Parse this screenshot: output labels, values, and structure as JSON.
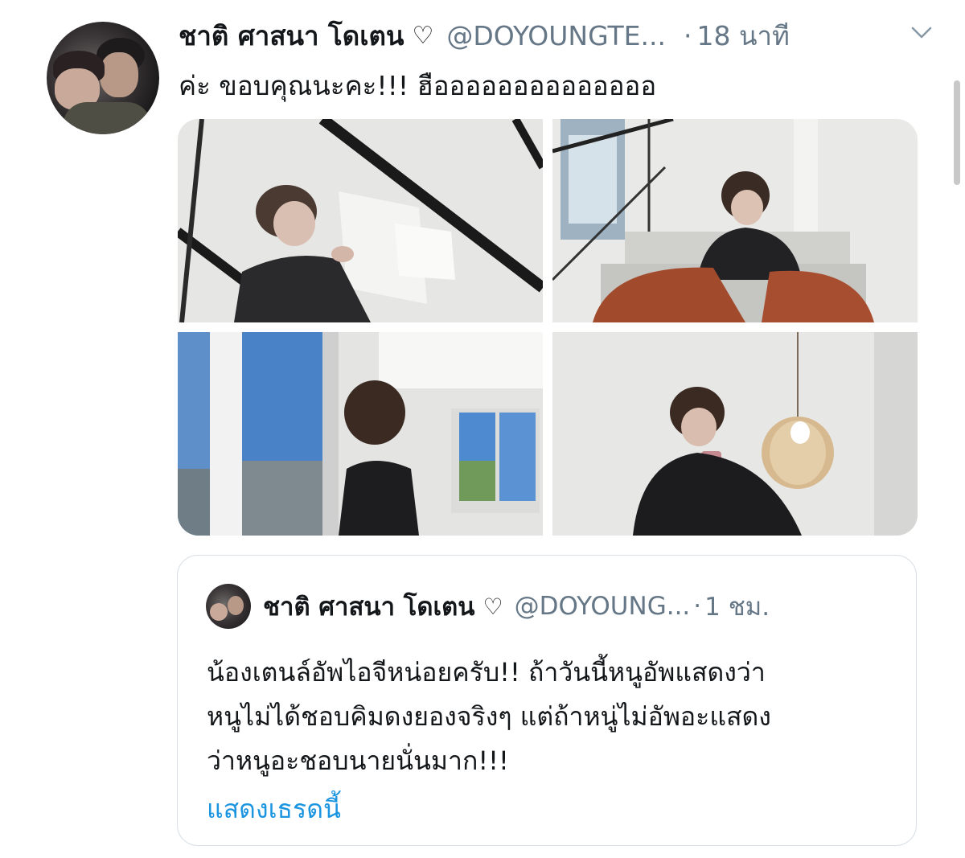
{
  "tweet": {
    "display_name": "ชาติ ศาสนา โดเตน",
    "heart": "♡",
    "handle": "@DOYOUNGTE...",
    "dot": "·",
    "time": "18 นาที",
    "text": "ค่ะ ขอบคุณนะคะ!!! ฮืออออออออออออออ",
    "media_count": 4
  },
  "quote": {
    "display_name": "ชาติ ศาสนา โดเตน",
    "heart": "♡",
    "handle": "@DOYOUNG...",
    "dot": "·",
    "time": "1 ชม.",
    "lines": [
      "น้องเตนล์อัพไอจีหน่อยครับ!! ถ้าวันนี้หนูอัพแสดงว่า",
      "หนูไม่ได้ชอบคิมดงยองจริงๆ แต่ถ้าหนู่ไม่อัพอะแสดง",
      "ว่าหนูอะชอบนายนั่นมาก!!!"
    ],
    "show_thread": "แสดงเธรดนี้"
  },
  "icons": {
    "more": "chevron-down-icon",
    "like": "heart-outline"
  },
  "colors": {
    "text": "#14171a",
    "secondary": "#657786",
    "link": "#1b95e0",
    "border": "#d8dee3"
  }
}
